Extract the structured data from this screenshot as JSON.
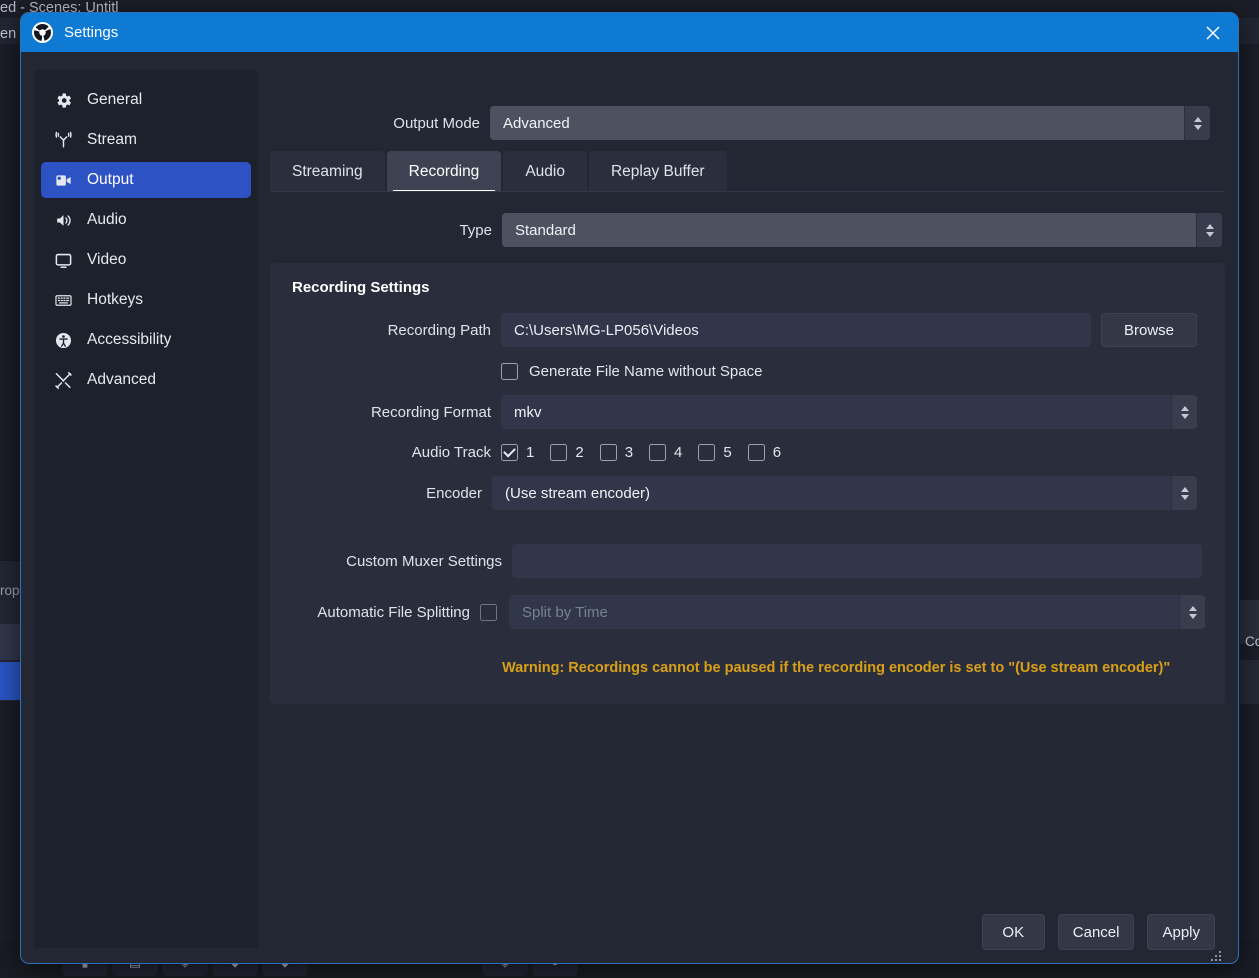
{
  "background": {
    "window_title_fragment": "ed - Scenes: Untitl",
    "menu_fragment": "en",
    "left_panel_fragment": "rop",
    "right_panel_fragment": "Co"
  },
  "dialog": {
    "title": "Settings",
    "logo_icon": "obs-logo-icon",
    "close_icon": "close-icon"
  },
  "sidebar": {
    "items": [
      {
        "label": "General",
        "icon": "gear-icon",
        "selected": false
      },
      {
        "label": "Stream",
        "icon": "broadcast-icon",
        "selected": false
      },
      {
        "label": "Output",
        "icon": "video-output-icon",
        "selected": true
      },
      {
        "label": "Audio",
        "icon": "speaker-icon",
        "selected": false
      },
      {
        "label": "Video",
        "icon": "monitor-icon",
        "selected": false
      },
      {
        "label": "Hotkeys",
        "icon": "keyboard-icon",
        "selected": false
      },
      {
        "label": "Accessibility",
        "icon": "accessibility-icon",
        "selected": false
      },
      {
        "label": "Advanced",
        "icon": "tools-icon",
        "selected": false
      }
    ]
  },
  "output_mode": {
    "label": "Output Mode",
    "value": "Advanced"
  },
  "tabs": [
    {
      "label": "Streaming",
      "active": false
    },
    {
      "label": "Recording",
      "active": true
    },
    {
      "label": "Audio",
      "active": false
    },
    {
      "label": "Replay Buffer",
      "active": false
    }
  ],
  "type_row": {
    "label": "Type",
    "value": "Standard"
  },
  "recording_settings": {
    "group_title": "Recording Settings",
    "recording_path": {
      "label": "Recording Path",
      "value": "C:\\Users\\MG-LP056\\Videos",
      "browse_label": "Browse"
    },
    "generate_no_space": {
      "label": "Generate File Name without Space",
      "checked": false
    },
    "recording_format": {
      "label": "Recording Format",
      "value": "mkv"
    },
    "audio_track": {
      "label": "Audio Track",
      "tracks": [
        {
          "label": "1",
          "checked": true
        },
        {
          "label": "2",
          "checked": false
        },
        {
          "label": "3",
          "checked": false
        },
        {
          "label": "4",
          "checked": false
        },
        {
          "label": "5",
          "checked": false
        },
        {
          "label": "6",
          "checked": false
        }
      ]
    },
    "encoder": {
      "label": "Encoder",
      "value": "(Use stream encoder)"
    },
    "custom_muxer": {
      "label": "Custom Muxer Settings",
      "value": ""
    },
    "file_splitting": {
      "label": "Automatic File Splitting",
      "checked": false,
      "value": "Split by Time",
      "disabled": true
    },
    "warning": "Warning: Recordings cannot be paused if the recording encoder is set to \"(Use stream encoder)\""
  },
  "footer": {
    "ok_label": "OK",
    "cancel_label": "Cancel",
    "apply_label": "Apply"
  },
  "colors": {
    "titlebar_blue": "#0f7ad4",
    "selection_blue": "#2d52c4",
    "warning_amber": "#d9a017",
    "dialog_bg": "#232733",
    "panel_bg": "#2a2e3c"
  }
}
